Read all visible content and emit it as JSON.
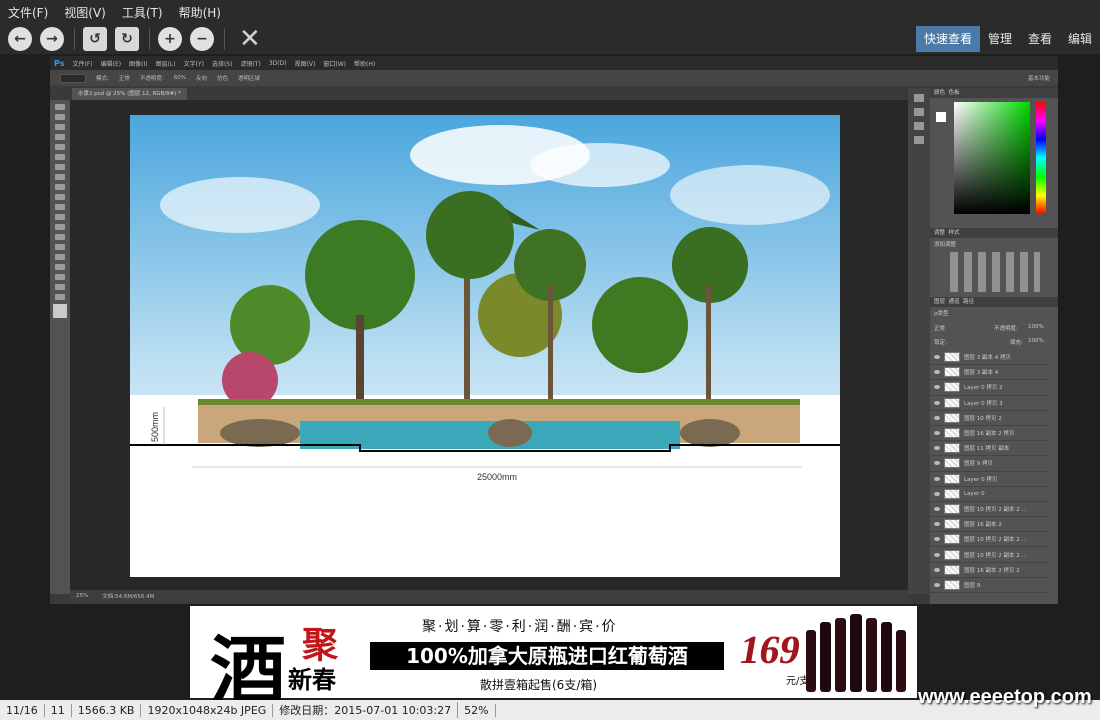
{
  "menu": [
    "文件(F)",
    "视图(V)",
    "工具(T)",
    "帮助(H)"
  ],
  "toolbar": {
    "icons": [
      "back-icon",
      "forward-icon",
      "rotate-left-icon",
      "rotate-right-icon",
      "zoom-in-icon",
      "zoom-out-icon",
      "delete-icon"
    ]
  },
  "view_tabs": [
    {
      "label": "快速查看",
      "active": true
    },
    {
      "label": "管理",
      "active": false
    },
    {
      "label": "查看",
      "active": false
    },
    {
      "label": "编辑",
      "active": false
    }
  ],
  "photoshop": {
    "logo": "Ps",
    "menu": [
      "文件(F)",
      "编辑(E)",
      "图像(I)",
      "图层(L)",
      "文字(Y)",
      "选择(S)",
      "滤镜(T)",
      "3D(D)",
      "视图(V)",
      "窗口(W)",
      "帮助(H)"
    ],
    "options": {
      "mode_label": "模式:",
      "mode_value": "正常",
      "opacity_label": "不透明度:",
      "opacity_value": "60%",
      "reverse": "反向",
      "dither": "仿色",
      "transparency": "透明区域",
      "workspace": "基本功能"
    },
    "doc_tab": "水景2.psd @ 25% (图层 12, RGB/8#) *",
    "status": {
      "zoom": "25%",
      "doc": "文档:54.6M/656.4M"
    },
    "panels": {
      "color_tabs": [
        "颜色",
        "色板"
      ],
      "adjust_tabs": [
        "调整",
        "样式"
      ],
      "adjust_title": "添加调整",
      "layer_tabs": [
        "图层",
        "通道",
        "路径"
      ],
      "filter": "ρ类型",
      "blend": "正常",
      "opacity_label": "不透明度:",
      "opacity": "100%",
      "lock_label": "锁定:",
      "fill_label": "填充:",
      "fill": "100%"
    },
    "layers": [
      "图层 3 副本 4 拷贝",
      "图层 3 副本 4",
      "Layer 0 拷贝 2",
      "Layer 0 拷贝 3",
      "图层 10 拷贝 2",
      "图层 16 副本 2 拷贝",
      "图层 11 拷贝 副本",
      "图层 9 拷贝",
      "Layer 0 拷贝",
      "Layer 0",
      "图层 10 拷贝 2 副本 2 ...",
      "图层 16 副本 2",
      "图层 10 拷贝 2 副本 2 ...",
      "图层 10 拷贝 2 副本 2 ...",
      "图层 16 副本 2 拷贝 2",
      "图层 9"
    ]
  },
  "drawing": {
    "width_dim": "25000mm",
    "height_dim": "500mm"
  },
  "ad": {
    "big_char": "酒",
    "red_char": "聚",
    "sub_chars": "新春",
    "slogan": "聚·划·算·零·利·润·酬·宾·价",
    "headline": "100%加拿大原瓶进口红葡萄酒",
    "note": "散拼壹箱起售(6支/箱)",
    "price": "169",
    "unit": "元/支"
  },
  "status": [
    "11/16",
    "11",
    "1566.3 KB",
    "1920x1048x24b JPEG",
    "修改日期：2015-07-01 10:03:27",
    "52%"
  ],
  "watermark": "www.eeeetop.com"
}
